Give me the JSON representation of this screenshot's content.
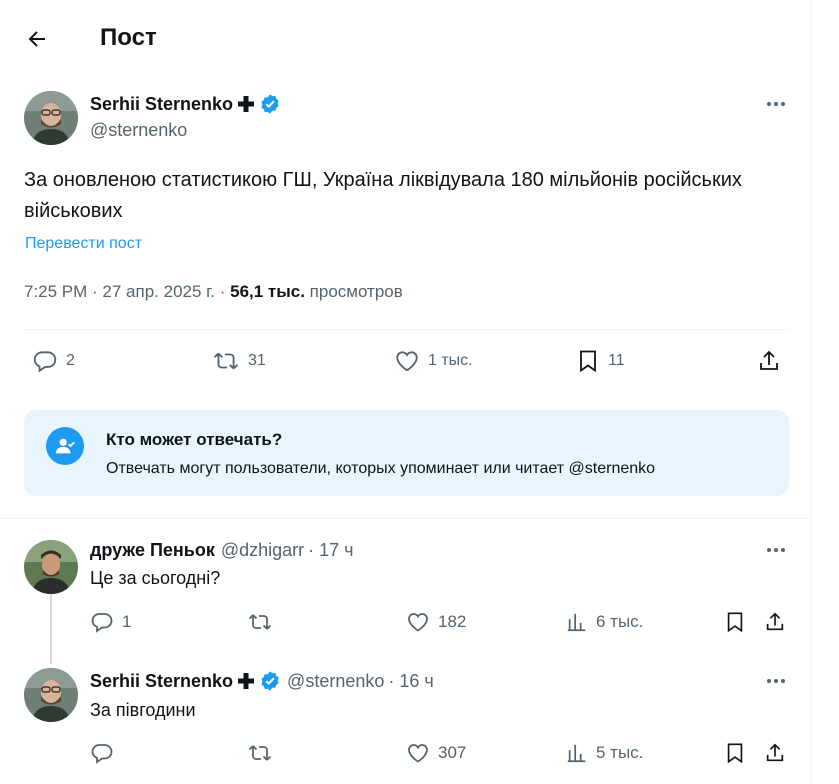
{
  "header": {
    "title": "Пост"
  },
  "post": {
    "author_name": "Serhii Sternenko",
    "author_handle": "@sternenko",
    "text": "За оновленою статистикою ГШ, Україна ліквідувала 180 мільйонів російських військових",
    "translate_label": "Перевести пост",
    "time": "7:25 PM · 27 апр. 2025 г. · ",
    "views_count": "56,1 тыс.",
    "views_label": " просмотров",
    "actions": {
      "replies": "2",
      "reposts": "31",
      "likes": "1 тыс.",
      "bookmarks": "11"
    }
  },
  "notice": {
    "title": "Кто может отвечать?",
    "text": "Отвечать могут пользователи, которых упоминает или читает @sternenko"
  },
  "replies": [
    {
      "name": "друже Пеньок",
      "handle": "@dzhigarr",
      "time": "· 17 ч",
      "text": "Це за сьогодні?",
      "actions": {
        "replies": "1",
        "reposts": "",
        "likes": "182",
        "views": "6 тыс."
      }
    },
    {
      "name": "Serhii Sternenko",
      "handle": "@sternenko",
      "time": "· 16 ч",
      "text": "За півгодини",
      "actions": {
        "replies": "",
        "reposts": "",
        "likes": "307",
        "views": "5 тыс."
      }
    }
  ],
  "colors": {
    "accent": "#1d9bf0",
    "muted": "#536471",
    "text": "#0f1419",
    "notice_bg": "#e8f5fd"
  }
}
